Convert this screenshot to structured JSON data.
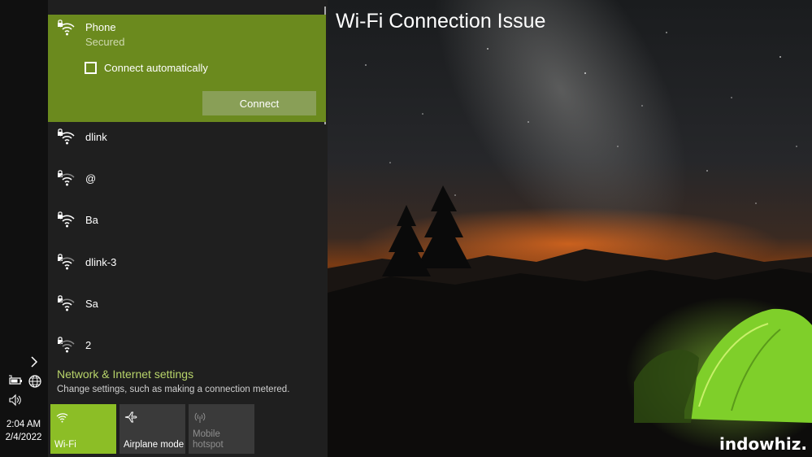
{
  "video": {
    "title": "Wi-Fi Connection Issue",
    "watermark": "indowhiz."
  },
  "colors": {
    "accent": "#6b8a1e",
    "accent_tile": "#8cbe26",
    "link": "#b8d46a",
    "flyout_bg": "#1f1f1f"
  },
  "taskbar": {
    "time": "2:04 AM",
    "date": "2/4/2022"
  },
  "selected_network": {
    "name": "Phone",
    "status": "Secured",
    "connect_auto_label": "Connect automatically",
    "connect_auto_checked": false,
    "connect_button": "Connect"
  },
  "networks": [
    {
      "name": "dlink"
    },
    {
      "name": "@"
    },
    {
      "name": "Ba"
    },
    {
      "name": "dlink-3"
    },
    {
      "name": "Sa"
    },
    {
      "name": "2"
    }
  ],
  "settings": {
    "link": "Network & Internet settings",
    "description": "Change settings, such as making a connection metered."
  },
  "quick_actions": [
    {
      "label": "Wi-Fi",
      "icon": "wifi-icon",
      "active": true
    },
    {
      "label": "Airplane mode",
      "icon": "airplane-icon",
      "active": false
    },
    {
      "label_line1": "Mobile",
      "label_line2": "hotspot",
      "icon": "hotspot-icon",
      "active": false,
      "disabled": true
    }
  ]
}
